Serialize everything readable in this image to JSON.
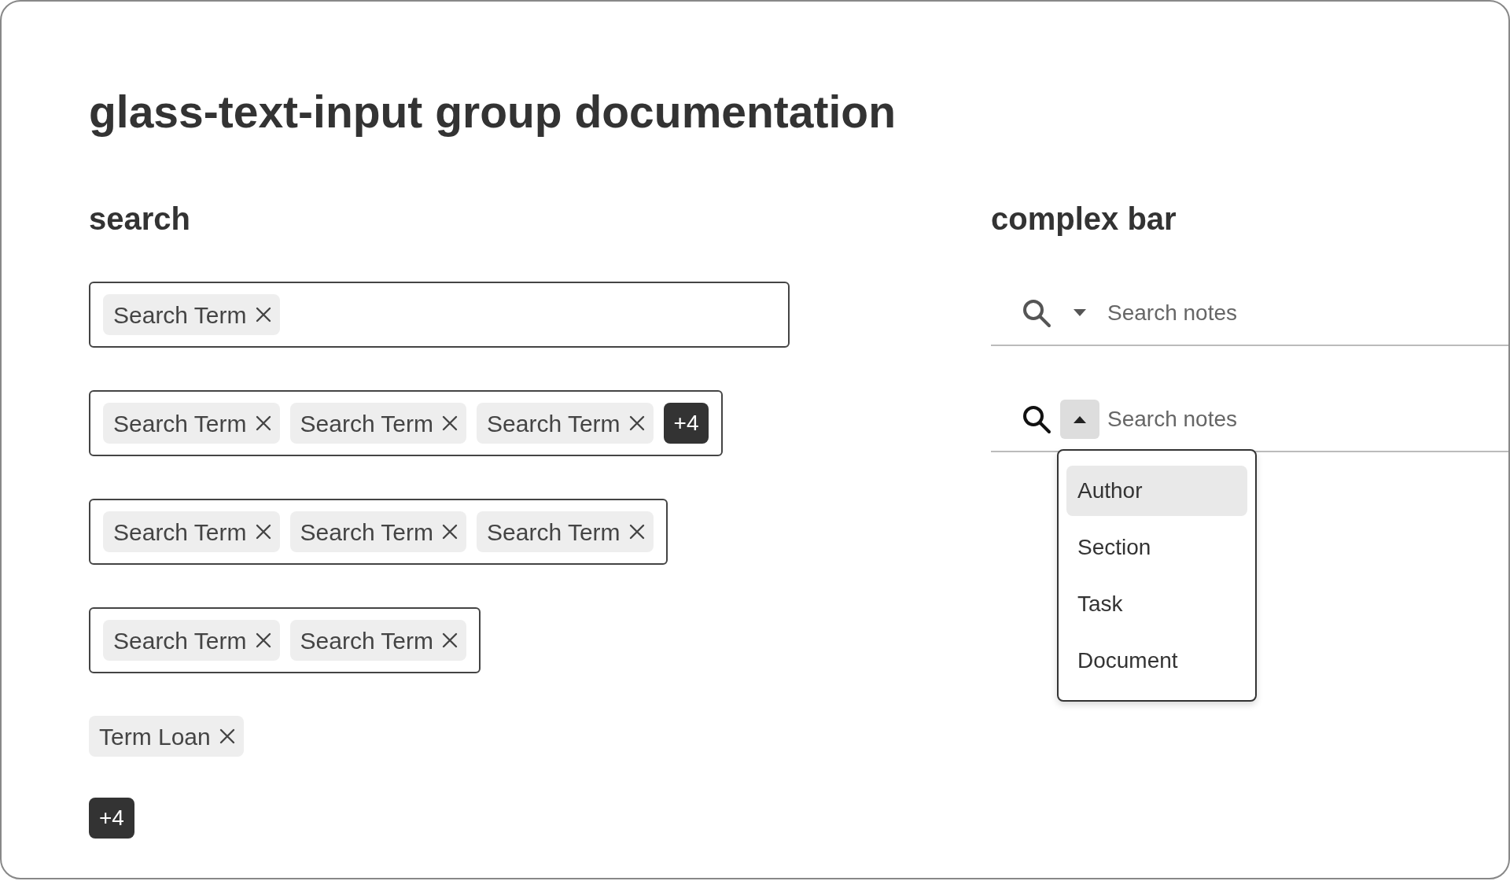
{
  "title": "glass-text-input group documentation",
  "search": {
    "heading": "search",
    "fields": [
      {
        "kind": "full",
        "tags": [
          "Search Term"
        ]
      },
      {
        "kind": "fit",
        "tags": [
          "Search Term",
          "Search Term",
          "Search Term"
        ],
        "overflow": "+4"
      },
      {
        "kind": "fit",
        "tags": [
          "Search Term",
          "Search Term",
          "Search Term"
        ]
      },
      {
        "kind": "fit",
        "tags": [
          "Search Term",
          "Search Term"
        ]
      }
    ],
    "loose": [
      {
        "kind": "tag",
        "label": "Term Loan"
      },
      {
        "kind": "count",
        "label": "+4"
      }
    ]
  },
  "complex_bar": {
    "heading": "complex bar",
    "bars": [
      {
        "placeholder": "Search notes",
        "expanded": false
      },
      {
        "placeholder": "Search notes",
        "expanded": true,
        "menu": [
          {
            "label": "Author",
            "selected": true
          },
          {
            "label": "Section",
            "selected": false
          },
          {
            "label": "Task",
            "selected": false
          },
          {
            "label": "Document",
            "selected": false
          }
        ]
      }
    ]
  }
}
